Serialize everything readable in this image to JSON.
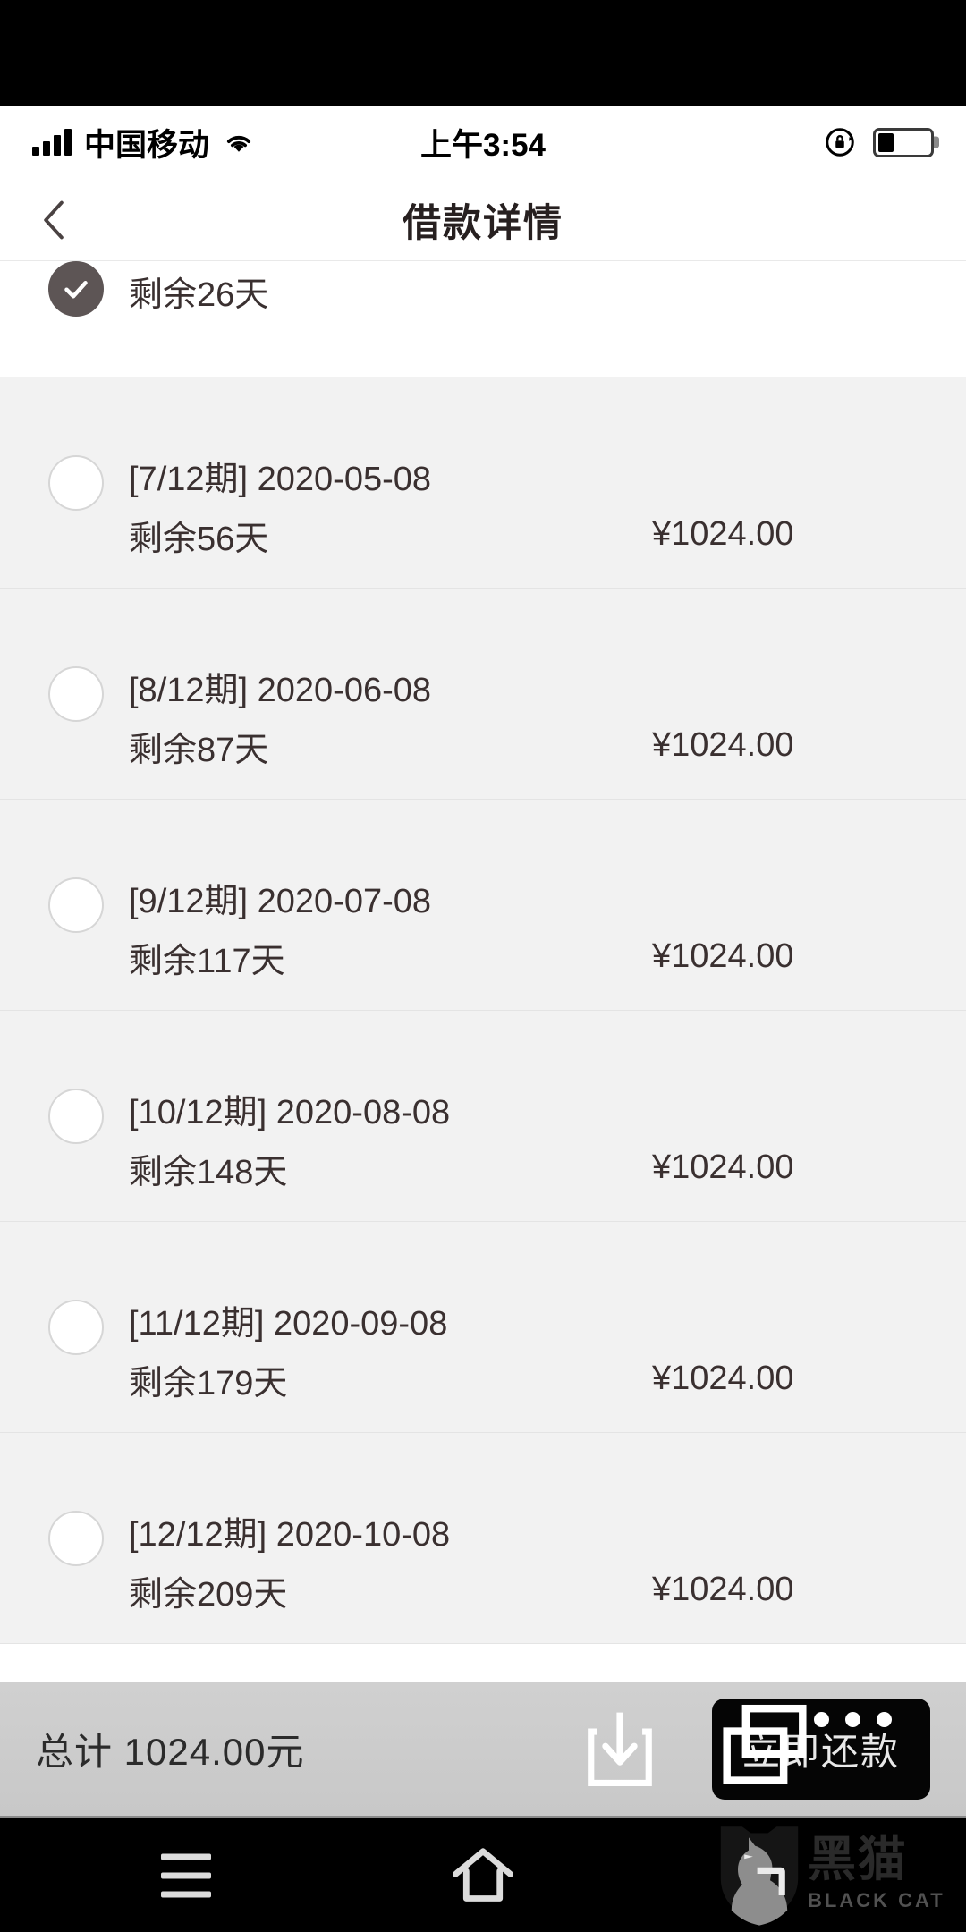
{
  "status_bar": {
    "carrier": "中国移动",
    "time": "上午3:54",
    "signal_icon": "signal-bars-icon",
    "wifi_icon": "wifi-icon",
    "rotation_lock_icon": "rotation-lock-icon",
    "battery_icon": "battery-icon",
    "battery_level_percent": 30
  },
  "nav_bar": {
    "back_icon": "chevron-left-icon",
    "title": "借款详情"
  },
  "list": {
    "rows": [
      {
        "period": "",
        "date": "",
        "remaining": "剩余26天",
        "amount": "",
        "checked": true,
        "partial": true
      },
      {
        "period": "[7/12期]",
        "date": "2020-05-08",
        "line1": "[7/12期] 2020-05-08",
        "remaining": "剩余56天",
        "amount": "¥1024.00",
        "checked": false,
        "partial": false
      },
      {
        "period": "[8/12期]",
        "date": "2020-06-08",
        "line1": "[8/12期] 2020-06-08",
        "remaining": "剩余87天",
        "amount": "¥1024.00",
        "checked": false,
        "partial": false
      },
      {
        "period": "[9/12期]",
        "date": "2020-07-08",
        "line1": "[9/12期] 2020-07-08",
        "remaining": "剩余117天",
        "amount": "¥1024.00",
        "checked": false,
        "partial": false
      },
      {
        "period": "[10/12期]",
        "date": "2020-08-08",
        "line1": "[10/12期] 2020-08-08",
        "remaining": "剩余148天",
        "amount": "¥1024.00",
        "checked": false,
        "partial": false
      },
      {
        "period": "[11/12期]",
        "date": "2020-09-08",
        "line1": "[11/12期] 2020-09-08",
        "remaining": "剩余179天",
        "amount": "¥1024.00",
        "checked": false,
        "partial": false
      },
      {
        "period": "[12/12期]",
        "date": "2020-10-08",
        "line1": "[12/12期] 2020-10-08",
        "remaining": "剩余209天",
        "amount": "¥1024.00",
        "checked": false,
        "partial": false
      }
    ]
  },
  "bottom_bar": {
    "total_label": "总计 1024.00元",
    "repay_button": "立即还款",
    "download_icon": "download-icon",
    "recent-apps_icon": "multi-window-icon",
    "more_icon": "three-dots-icon"
  },
  "android_nav": {
    "menu_icon": "hamburger-menu-icon",
    "home_icon": "home-icon"
  },
  "watermark": {
    "logo_icon": "black-cat-shield-icon",
    "name_cn": "黑猫",
    "name_en": "BLACK CAT"
  },
  "colors": {
    "checked_fill": "#5d5555",
    "row_bg": "#f2f2f2",
    "text": "#3a3030",
    "button_bg": "#050505",
    "bottom_bar_bg": "#c8c8c8"
  }
}
